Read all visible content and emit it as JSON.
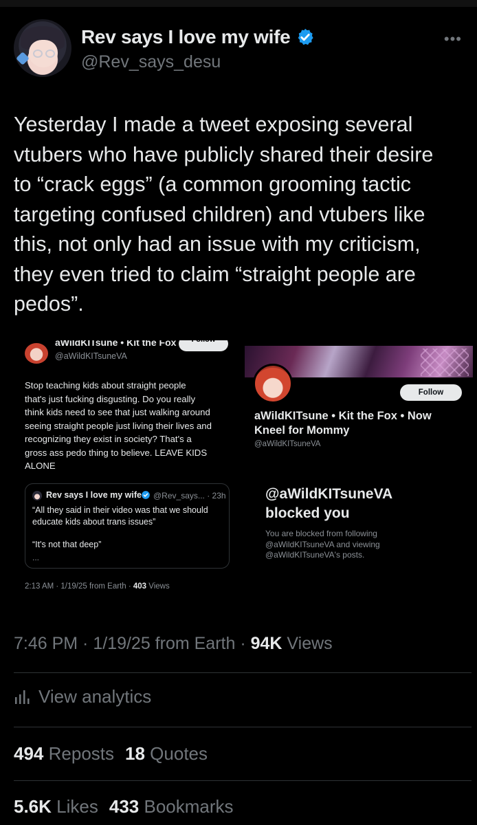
{
  "author": {
    "display_name": "Rev says I love my wife",
    "handle": "@Rev_says_desu",
    "more_icon": "more-dots-icon",
    "verified_color": "#1d9bf0"
  },
  "tweet": {
    "text": "Yesterday I made a tweet exposing several\nvtubers who have publicly shared their desire\nto “crack eggs” (a common grooming tactic\ntargeting confused children) and vtubers like\nthis, not only had an issue with my criticism,\nthey even tried to claim “straight people are\npedos”."
  },
  "embed_left": {
    "header_cut": "aWildKITsune • Kit the Fox •...",
    "follow_label": "Follow",
    "handle": "@aWildKITsuneVA",
    "body": "Stop teaching kids about straight people\nthat's just fucking disgusting. Do you really\nthink kids need to see that just walking around\nseeing straight people just living their lives and\nrecognizing they exist in society? That's a\ngross ass pedo thing to believe. LEAVE KIDS\nALONE",
    "quote": {
      "name": "Rev says I love my wife",
      "meta": "@Rev_says... · 23h",
      "text": "“All they said in their video was that we should\neducate kids about trans issues”\n\n“It's not that deep”",
      "ellipsis": "..."
    },
    "footer_prefix": "2:13 AM · 1/19/25 from Earth · ",
    "footer_views_num": "403",
    "footer_views_label": " Views"
  },
  "embed_right": {
    "follow_label": "Follow",
    "name": "aWildKITsune • Kit the Fox • Now Kneel for Mommy",
    "handle": "@aWildKITsuneVA",
    "blocked_title": "@aWildKITsuneVA\nblocked you",
    "blocked_desc": "You are blocked from following\n@aWildKITsuneVA and viewing\n@aWildKITsuneVA's posts."
  },
  "meta": {
    "time_prefix": "7:46 PM · 1/19/25 from Earth · ",
    "views_num": "94K",
    "views_label": " Views"
  },
  "analytics": {
    "label": "View analytics",
    "icon": "analytics-bars-icon"
  },
  "stats": {
    "reposts_num": "494",
    "reposts_label": "Reposts",
    "quotes_num": "18",
    "quotes_label": "Quotes",
    "likes_num": "5.6K",
    "likes_label": "Likes",
    "bookmarks_num": "433",
    "bookmarks_label": "Bookmarks"
  }
}
